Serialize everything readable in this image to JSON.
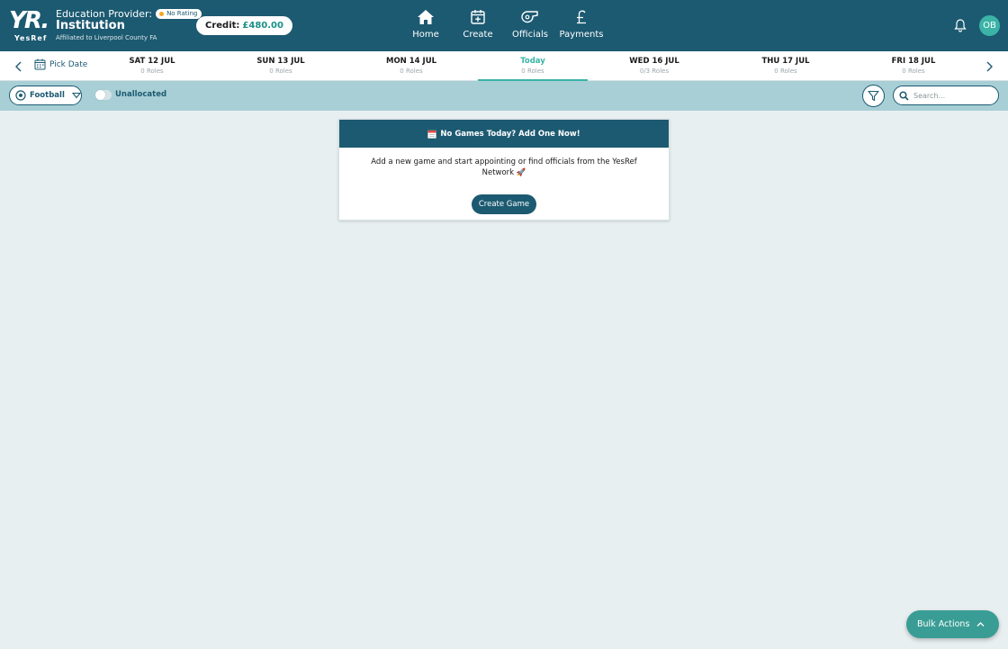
{
  "header": {
    "logo_text": "YR.",
    "logo_sub": "YesRef",
    "provider_label": "Education Provider:",
    "rating_badge": "No Rating",
    "institution": "Institution",
    "affiliation": "Affiliated to Liverpool County FA",
    "credit_label": "Credit:",
    "credit_amount": "£480.00",
    "nav": [
      {
        "label": "Home",
        "icon": "home-icon"
      },
      {
        "label": "Create",
        "icon": "calendar-plus-icon"
      },
      {
        "label": "Officials",
        "icon": "whistle-icon"
      },
      {
        "label": "Payments",
        "icon": "pound-icon"
      }
    ],
    "avatar_initials": "OB"
  },
  "datebar": {
    "pick_date": "Pick Date",
    "days": [
      {
        "date": "SAT 12 JUL",
        "roles": "0 Roles"
      },
      {
        "date": "SUN 13 JUL",
        "roles": "0 Roles"
      },
      {
        "date": "MON 14 JUL",
        "roles": "0 Roles"
      },
      {
        "date": "Today",
        "roles": "0 Roles",
        "active": true
      },
      {
        "date": "WED 16 JUL",
        "roles": "0/3 Roles"
      },
      {
        "date": "THU 17 JUL",
        "roles": "0 Roles"
      },
      {
        "date": "FRI 18 JUL",
        "roles": "0 Roles"
      }
    ]
  },
  "filters": {
    "sport": "Football",
    "unallocated_label": "Unallocated",
    "search_placeholder": "Search..."
  },
  "card": {
    "title": "No Games Today? Add One Now!",
    "body_line1": "Add a new game and start appointing or find officials from the YesRef",
    "body_line2": "Network 🚀",
    "button": "Create Game"
  },
  "bulk_actions": "Bulk Actions",
  "colors": {
    "primary": "#1c5a71",
    "accent": "#3bb3a7",
    "filter_bar": "#a8cfd6",
    "background": "#e8eff1"
  }
}
